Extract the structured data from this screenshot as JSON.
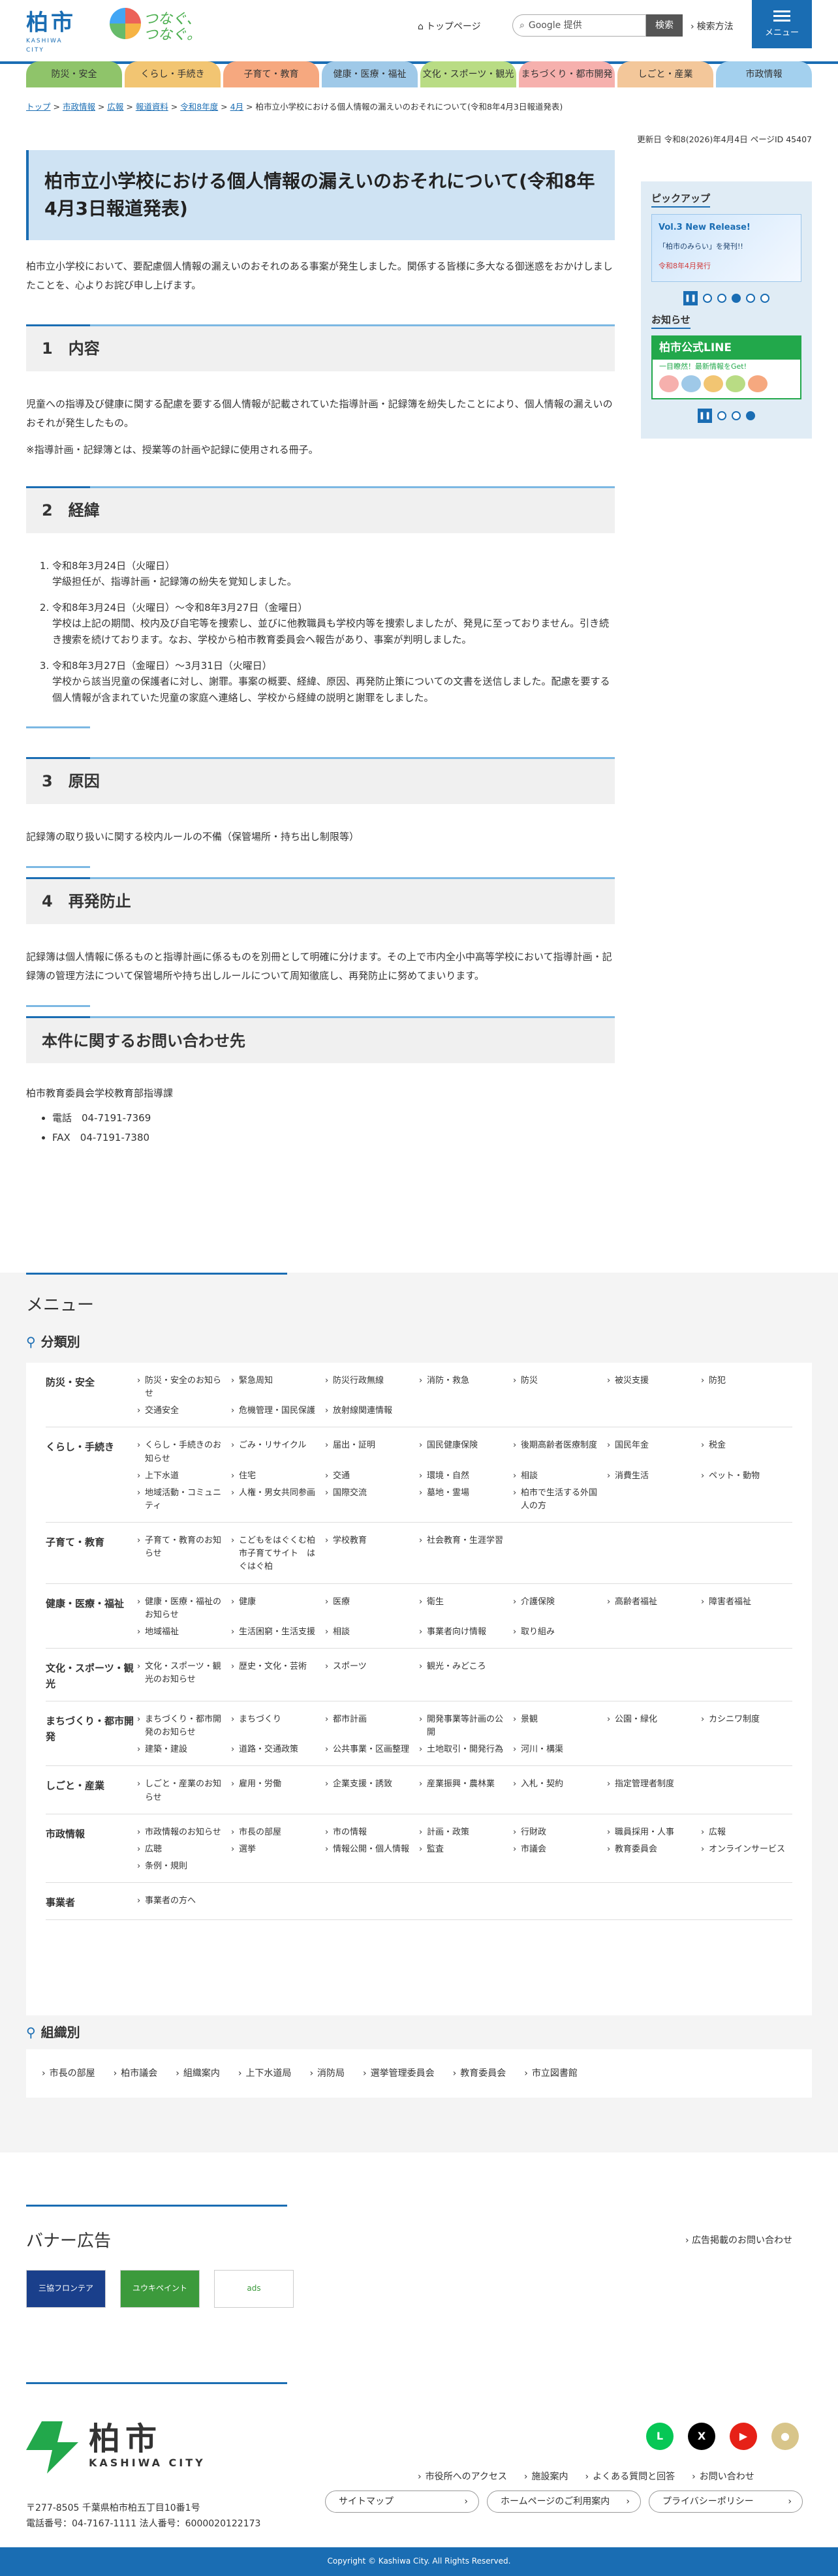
{
  "header": {
    "logo": "柏市",
    "logo_en": "KASHIWA CITY",
    "slogan": "つなぐ、つなぐ。",
    "top_page": "トップページ",
    "search_placeholder": "Google 提供",
    "search_button": "検索",
    "search_method": "検索方法",
    "menu": "メニュー"
  },
  "nav": [
    {
      "label": "防災・安全",
      "color": "#8fc46a"
    },
    {
      "label": "くらし・手続き",
      "color": "#f2c572"
    },
    {
      "label": "子育て・教育",
      "color": "#f6a87f"
    },
    {
      "label": "健康・医療・福祉",
      "color": "#9fc9e8"
    },
    {
      "label": "文化・スポーツ・観光",
      "color": "#b9dc84"
    },
    {
      "label": "まちづくり・都市開発",
      "color": "#f6b0ad"
    },
    {
      "label": "しごと・産業",
      "color": "#f3c79a"
    },
    {
      "label": "市政情報",
      "color": "#a3d0ee"
    }
  ],
  "breadcrumb": {
    "items": [
      "トップ",
      "市政情報",
      "広報",
      "報道資料",
      "令和8年度",
      "4月"
    ],
    "current": "柏市立小学校における個人情報の漏えいのおそれについて(令和8年4月3日報道発表)"
  },
  "meta": {
    "updated": "更新日 令和8(2026)年4月4日",
    "page_id": "ページID 45407"
  },
  "article": {
    "title": "柏市立小学校における個人情報の漏えいのおそれについて(令和8年4月3日報道発表)",
    "lead": "柏市立小学校において、要配慮個人情報の漏えいのおそれのある事案が発生しました。関係する皆様に多大なる御迷惑をおかけしましたことを、心よりお詫び申し上げます。",
    "s1_title": "1　内容",
    "s1_text": "児童への指導及び健康に関する配慮を要する個人情報が記載されていた指導計画・記録簿を紛失したことにより、個人情報の漏えいのおそれが発生したもの。",
    "s1_note": "※指導計画・記録簿とは、授業等の計画や記録に使用される冊子。",
    "s2_title": "2　経緯",
    "s2_items": [
      {
        "date": "令和8年3月24日（火曜日）",
        "text": "学級担任が、指導計画・記録簿の紛失を覚知しました。"
      },
      {
        "date": "令和8年3月24日（火曜日）～令和8年3月27日（金曜日）",
        "text": "学校は上記の期間、校内及び自宅等を捜索し、並びに他教職員も学校内等を捜索しましたが、発見に至っておりません。引き続き捜索を続けております。なお、学校から柏市教育委員会へ報告があり、事案が判明しました。"
      },
      {
        "date": "令和8年3月27日（金曜日）～3月31日（火曜日）",
        "text": "学校から該当児童の保護者に対し、謝罪。事案の概要、経緯、原因、再発防止策についての文書を送信しました。配慮を要する個人情報が含まれていた児童の家庭へ連絡し、学校から経緯の説明と謝罪をしました。"
      }
    ],
    "s3_title": "3　原因",
    "s3_text": "記録簿の取り扱いに関する校内ルールの不備（保管場所・持ち出し制限等）",
    "s4_title": "4　再発防止",
    "s4_text": "記録簿は個人情報に係るものと指導計画に係るものを別冊として明確に分けます。その上で市内全小中高等学校において指導計画・記録簿の管理方法について保管場所や持ち出しルールについて周知徹底し、再発防止に努めてまいります。",
    "contact_title": "本件に関するお問い合わせ先",
    "contact_org": "柏市教育委員会学校教育部指導課",
    "tel": "電話　04-7191-7369",
    "fax": "FAX　04-7191-7380"
  },
  "aside": {
    "pickup": "ピックアップ",
    "pickup_banner_title": "Vol.3 New Release!",
    "pickup_banner_sub": "「柏市のみらい」を発刊!!",
    "pickup_banner_note": "令和8年4月発行",
    "news": "お知らせ",
    "line_title": "柏市公式LINE",
    "line_sub": "一目瞭然！最新情報をGet!"
  },
  "menu": {
    "title": "メニュー",
    "by_category": "分類別",
    "by_org": "組織別",
    "categories": [
      {
        "name": "防災・安全",
        "links": [
          "防災・安全のお知らせ",
          "緊急周知",
          "防災行政無線",
          "消防・救急",
          "防災",
          "被災支援",
          "防犯",
          "交通安全",
          "危機管理・国民保護",
          "放射線関連情報"
        ]
      },
      {
        "name": "くらし・手続き",
        "links": [
          "くらし・手続きのお知らせ",
          "ごみ・リサイクル",
          "届出・証明",
          "国民健康保険",
          "後期高齢者医療制度",
          "国民年金",
          "税金",
          "上下水道",
          "住宅",
          "交通",
          "環境・自然",
          "相談",
          "消費生活",
          "ペット・動物",
          "地域活動・コミュニティ",
          "人権・男女共同参画",
          "国際交流",
          "墓地・霊場",
          "柏市で生活する外国人の方"
        ]
      },
      {
        "name": "子育て・教育",
        "links": [
          "子育て・教育のお知らせ",
          "こどもをはぐくむ柏市子育てサイト　はぐはぐ柏",
          "学校教育",
          "社会教育・生涯学習"
        ]
      },
      {
        "name": "健康・医療・福祉",
        "links": [
          "健康・医療・福祉のお知らせ",
          "健康",
          "医療",
          "衛生",
          "介護保険",
          "高齢者福祉",
          "障害者福祉",
          "地域福祉",
          "生活困窮・生活支援",
          "相談",
          "事業者向け情報",
          "取り組み"
        ]
      },
      {
        "name": "文化・スポーツ・観光",
        "links": [
          "文化・スポーツ・観光のお知らせ",
          "歴史・文化・芸術",
          "スポーツ",
          "観光・みどころ"
        ]
      },
      {
        "name": "まちづくり・都市開発",
        "links": [
          "まちづくり・都市開発のお知らせ",
          "まちづくり",
          "都市計画",
          "開発事業等計画の公開",
          "景観",
          "公園・緑化",
          "カシニワ制度",
          "建築・建設",
          "道路・交通政策",
          "公共事業・区画整理",
          "土地取引・開発行為",
          "河川・構渠"
        ]
      },
      {
        "name": "しごと・産業",
        "links": [
          "しごと・産業のお知らせ",
          "雇用・労働",
          "企業支援・誘致",
          "産業振興・農林業",
          "入札・契約",
          "指定管理者制度"
        ]
      },
      {
        "name": "市政情報",
        "links": [
          "市政情報のお知らせ",
          "市長の部屋",
          "市の情報",
          "計画・政策",
          "行財政",
          "職員採用・人事",
          "広報",
          "広聴",
          "選挙",
          "情報公開・個人情報",
          "監査",
          "市議会",
          "教育委員会",
          "オンラインサービス",
          "条例・規則"
        ]
      },
      {
        "name": "事業者",
        "links": [
          "事業者の方へ"
        ]
      }
    ],
    "orgs": [
      "市長の部屋",
      "柏市議会",
      "組織案内",
      "上下水道局",
      "消防局",
      "選挙管理委員会",
      "教育委員会",
      "市立図書館"
    ]
  },
  "ads": {
    "title": "バナー広告",
    "info": "広告掲載のお問い合わせ",
    "items": [
      "三協フロンテア",
      "ユウキペイント",
      "ads"
    ]
  },
  "footer": {
    "name": "柏市",
    "name_en": "KASHIWA CITY",
    "address": "〒277-8505 千葉県柏市柏五丁目10番1号",
    "phone": "電話番号：04-7167-1111  法人番号：6000020122173",
    "links": [
      "市役所へのアクセス",
      "施設案内",
      "よくある質問と回答",
      "お問い合わせ"
    ],
    "buttons": [
      "サイトマップ",
      "ホームページのご利用案内",
      "プライバシーポリシー"
    ],
    "copyright": "Copyright © Kashiwa City. All Rights Reserved."
  }
}
